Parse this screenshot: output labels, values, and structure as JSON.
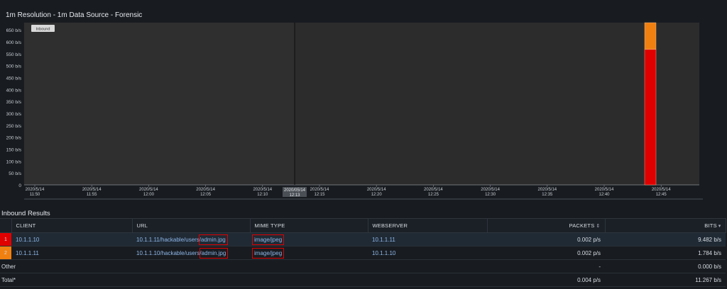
{
  "panel": {
    "title": "1m Resolution - 1m Data Source - Forensic"
  },
  "chart_data": {
    "type": "bar",
    "legend": [
      "Inbound"
    ],
    "ylabels": [
      "0",
      "50 b/s",
      "100 b/s",
      "150 b/s",
      "200 b/s",
      "250 b/s",
      "300 b/s",
      "350 b/s",
      "400 b/s",
      "450 b/s",
      "500 b/s",
      "550 b/s",
      "600 b/s",
      "650 b/s"
    ],
    "ylim": [
      0,
      680
    ],
    "xticks": [
      {
        "date": "2020/5/14",
        "time": "11:50"
      },
      {
        "date": "2020/5/14",
        "time": "11:55"
      },
      {
        "date": "2020/5/14",
        "time": "12:00"
      },
      {
        "date": "2020/5/14",
        "time": "12:05"
      },
      {
        "date": "2020/5/14",
        "time": "12:10"
      },
      {
        "date": "2020/5/14",
        "time": "12:15"
      },
      {
        "date": "2020/5/14",
        "time": "12:20"
      },
      {
        "date": "2020/5/14",
        "time": "12:25"
      },
      {
        "date": "2020/5/14",
        "time": "12:30"
      },
      {
        "date": "2020/5/14",
        "time": "12:35"
      },
      {
        "date": "2020/5/14",
        "time": "12:40"
      },
      {
        "date": "2020/5/14",
        "time": "12:45"
      }
    ],
    "cursor": {
      "date": "2020/05/14",
      "time": "12:13"
    },
    "bars": [
      {
        "time": "12:45",
        "series": "1",
        "value": 568,
        "color": "#e00000"
      },
      {
        "time": "12:45",
        "series": "2",
        "value": 112,
        "color": "#f08010"
      }
    ]
  },
  "results": {
    "title": "Inbound Results",
    "columns": {
      "client": "CLIENT",
      "url": "URL",
      "mime": "MIME TYPE",
      "webserver": "WEBSERVER",
      "packets": "PACKETS",
      "bits": "BITS"
    },
    "rows": [
      {
        "rank": "1",
        "client": "10.1.1.10",
        "url_prefix": "10.1.1.11/hackable/users/",
        "url_file": "admin.jpg",
        "mime": "image/jpeg",
        "webserver": "10.1.1.11",
        "packets": "0.002 p/s",
        "bits": "9.482 b/s"
      },
      {
        "rank": "2",
        "client": "10.1.1.11",
        "url_prefix": "10.1.1.10/hackable/users/",
        "url_file": "admin.jpg",
        "mime": "image/jpeg",
        "webserver": "10.1.1.10",
        "packets": "0.002 p/s",
        "bits": "1.784 b/s"
      }
    ],
    "other": {
      "label": "Other",
      "packets": "-",
      "bits": "0.000 b/s"
    },
    "total": {
      "label": "Total*",
      "packets": "0.004 p/s",
      "bits": "11.267 b/s"
    }
  }
}
